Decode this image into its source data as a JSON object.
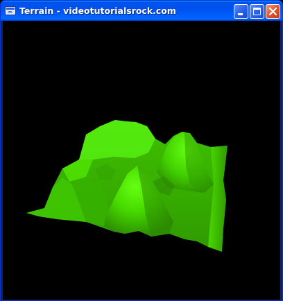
{
  "window": {
    "title": "Terrain - videotutorialsrock.com",
    "app_icon": "window-app-icon",
    "buttons": {
      "minimize_icon": "minimize-icon",
      "maximize_icon": "maximize-icon",
      "close_icon": "close-icon"
    }
  },
  "viewport": {
    "background": "#000000",
    "terrain_color": "#44d400"
  }
}
